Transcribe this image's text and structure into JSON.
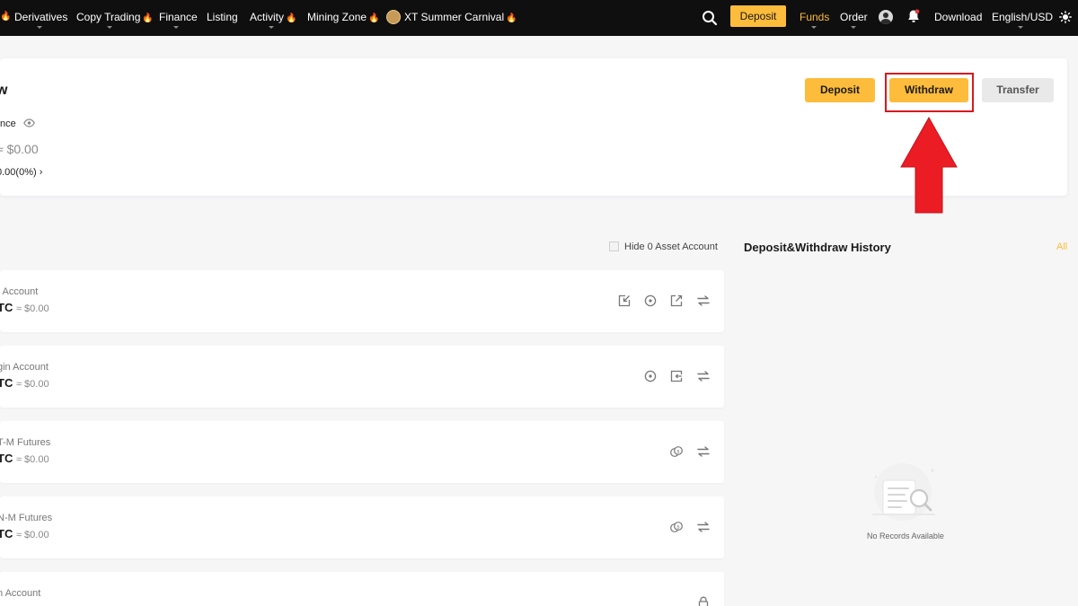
{
  "nav": {
    "items": [
      {
        "label": "Derivatives",
        "flame": false
      },
      {
        "label": "Copy Trading",
        "flame": true
      },
      {
        "label": "Finance",
        "flame": false
      },
      {
        "label": "Listing",
        "flame": false
      },
      {
        "label": "Activity",
        "flame": true
      },
      {
        "label": "Mining Zone",
        "flame": true
      },
      {
        "label": "XT Summer Carnival",
        "flame": true
      }
    ],
    "deposit_label": "Deposit",
    "funds_label": "Funds",
    "order_label": "Order",
    "download_label": "Download",
    "language_label": "English/USD",
    "flame_glyph": "🔥"
  },
  "overview": {
    "title_partial": "w",
    "balance_label_partial": "nce",
    "usd_value_partial": "≈ $0.00",
    "pnl_partial": "0.00(0%)",
    "pnl_chevron": "›",
    "buttons": {
      "deposit": "Deposit",
      "withdraw": "Withdraw",
      "transfer": "Transfer"
    }
  },
  "annotation": {
    "highlight_color": "#d7191f"
  },
  "accounts": {
    "hide_zero_label": "Hide 0 Asset Account",
    "list": [
      {
        "name": "t Account",
        "balance_unit": "TC",
        "usd": "≈ $0.00",
        "icons": [
          "deposit-icon",
          "history-icon",
          "withdraw-icon",
          "transfer-icon"
        ]
      },
      {
        "name": "gin Account",
        "balance_unit": "TC",
        "usd": "≈ $0.00",
        "icons": [
          "history-icon",
          "repay-icon",
          "transfer-icon"
        ]
      },
      {
        "name": "T-M Futures",
        "balance_unit": "TC",
        "usd": "≈ $0.00",
        "icons": [
          "coins-icon",
          "transfer-icon"
        ]
      },
      {
        "name": "N-M Futures",
        "balance_unit": "TC",
        "usd": "≈ $0.00",
        "icons": [
          "coins-icon",
          "transfer-icon"
        ]
      },
      {
        "name": "n Account",
        "balance_unit": "",
        "usd": "",
        "icons": [
          "lock-icon"
        ]
      }
    ]
  },
  "history": {
    "title": "Deposit&Withdraw History",
    "all_label": "All",
    "empty_text": "No Records Available"
  },
  "colors": {
    "accent": "#fdbc3b",
    "nav_bg": "#0f0f0f",
    "flame": "#f7931a"
  }
}
